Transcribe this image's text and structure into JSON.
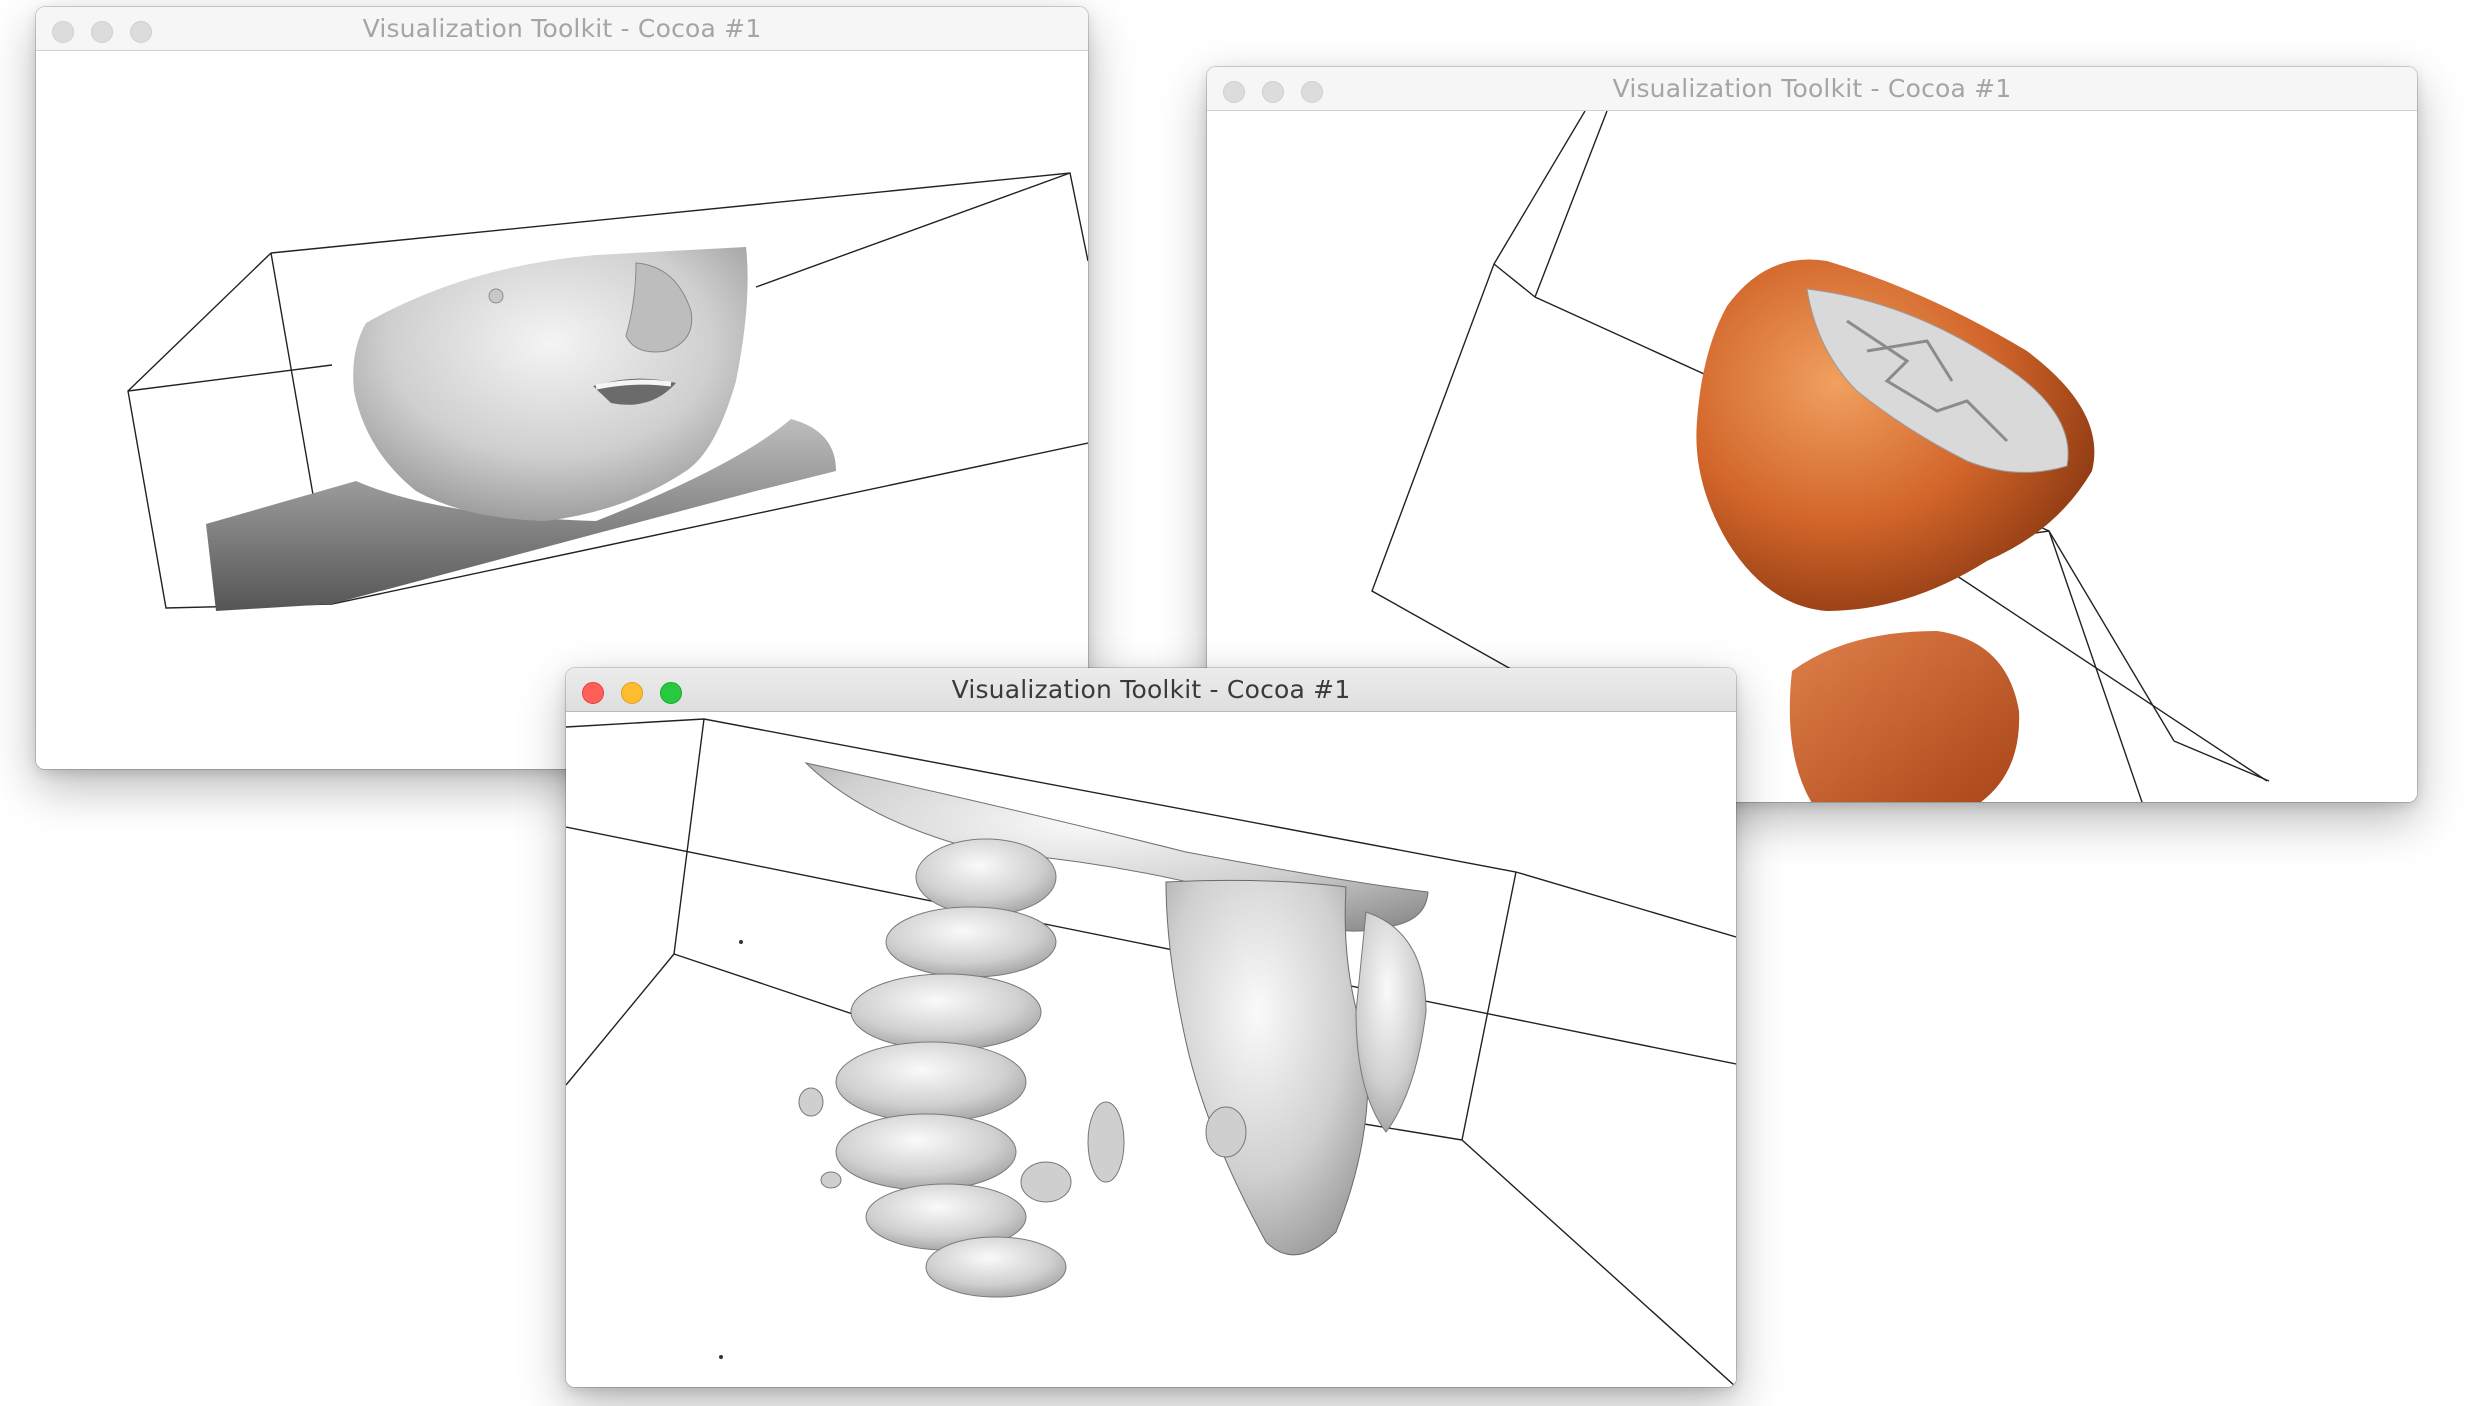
{
  "windows": [
    {
      "id": "face-surface",
      "title": "Visualization Toolkit - Cocoa #1",
      "state": "inactive",
      "render": "skin-surface",
      "surface_color": "#d4d4d4"
    },
    {
      "id": "skin-orange",
      "title": "Visualization Toolkit - Cocoa #1",
      "state": "inactive",
      "render": "skin-clipped-head",
      "surface_color": "#d76a2c"
    },
    {
      "id": "bone-surface",
      "title": "Visualization Toolkit - Cocoa #1",
      "state": "active",
      "render": "bone-isosurface",
      "surface_color": "#d8d8d8"
    }
  ],
  "traffic_lights": {
    "close_color": "#fe5f57",
    "minimize_color": "#febc2e",
    "zoom_color": "#28c840",
    "inactive_color": "#dcdcdc"
  },
  "icons": [
    "close-icon",
    "minimize-icon",
    "zoom-icon"
  ]
}
